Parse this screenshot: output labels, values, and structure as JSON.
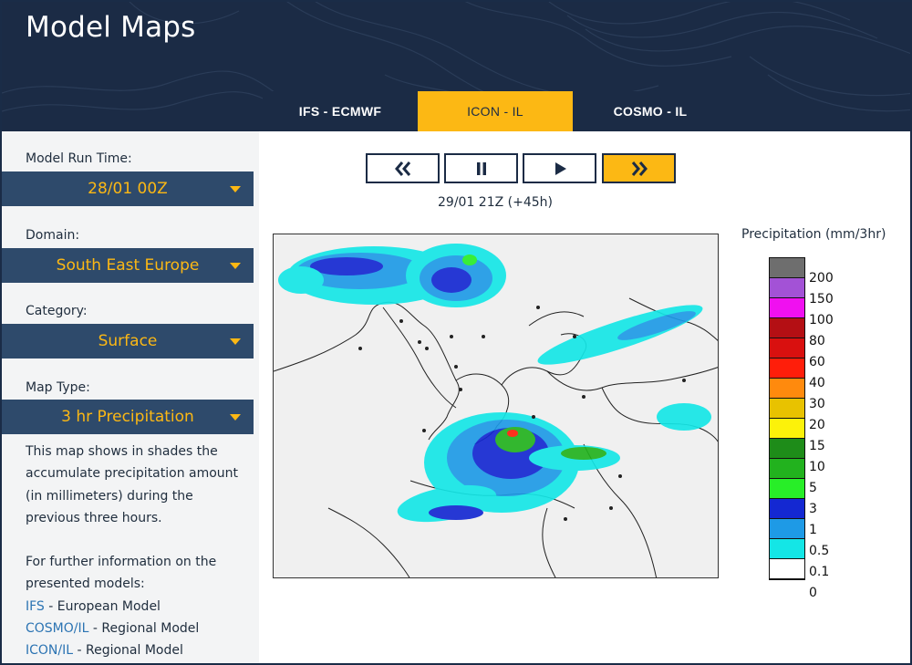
{
  "header": {
    "title": "Model Maps"
  },
  "tabs": [
    {
      "label": "IFS - ECMWF",
      "active": false
    },
    {
      "label": "ICON - IL",
      "active": true
    },
    {
      "label": "COSMO - IL",
      "active": false
    }
  ],
  "sidebar": {
    "run_time": {
      "label": "Model Run Time:",
      "value": "28/01 00Z"
    },
    "domain": {
      "label": "Domain:",
      "value": "South East Europe"
    },
    "category": {
      "label": "Category:",
      "value": "Surface"
    },
    "map_type": {
      "label": "Map Type:",
      "value": "3 hr Precipitation"
    },
    "description": "This map shows in shades the accumulate precipitation amount (in millimeters) during the previous three hours.",
    "info": {
      "intro": "For further information on the presented models:",
      "links": [
        {
          "name": "IFS",
          "text": " - European Model"
        },
        {
          "name": "COSMO/IL",
          "text": " - Regional Model"
        },
        {
          "name": "ICON/IL",
          "text": " - Regional Model"
        }
      ]
    }
  },
  "player": {
    "timestamp": "29/01 21Z (+45h)",
    "controls": [
      "rewind-icon",
      "pause-icon",
      "play-icon",
      "fast-forward-icon"
    ]
  },
  "legend": {
    "title": "Precipitation (mm/3hr)",
    "levels": [
      {
        "label": "200",
        "color": "#6e6e6e"
      },
      {
        "label": "150",
        "color": "#a352d6"
      },
      {
        "label": "100",
        "color": "#f010f0"
      },
      {
        "label": "80",
        "color": "#b40f14"
      },
      {
        "label": "60",
        "color": "#d9100f"
      },
      {
        "label": "40",
        "color": "#ff1e0a"
      },
      {
        "label": "30",
        "color": "#ff8a0d"
      },
      {
        "label": "20",
        "color": "#e8c200"
      },
      {
        "label": "15",
        "color": "#fcf20a"
      },
      {
        "label": "10",
        "color": "#1e8c19"
      },
      {
        "label": "5",
        "color": "#22b21e"
      },
      {
        "label": "3",
        "color": "#28ee28"
      },
      {
        "label": "1",
        "color": "#1428d2"
      },
      {
        "label": "0.5",
        "color": "#1e9ae6"
      },
      {
        "label": "0.1",
        "color": "#14e6e6"
      },
      {
        "label": "0",
        "color": "#ffffff"
      }
    ]
  },
  "colors": {
    "navy": "#1b2b45",
    "accent": "#fcb814",
    "select_bg": "#2e4a6b",
    "link": "#2c74b3"
  }
}
